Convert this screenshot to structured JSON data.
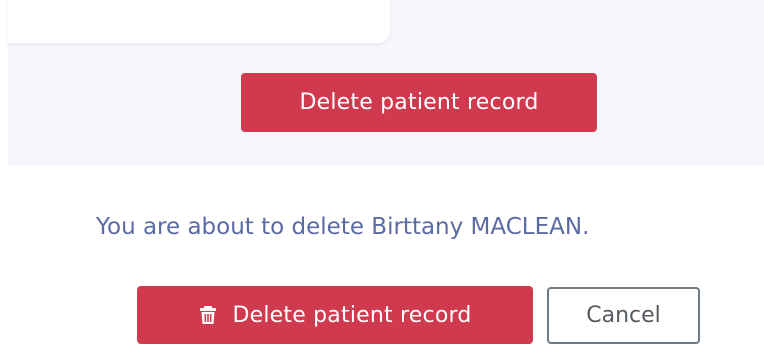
{
  "page": {
    "primary_delete_label": "Delete patient record",
    "confirmation": {
      "message": "You are about to delete Birttany MACLEAN.",
      "confirm_delete_label": "Delete patient record",
      "cancel_label": "Cancel"
    }
  },
  "icons": {
    "confirm_delete": "trash-icon"
  },
  "colors": {
    "danger": "#d03a4e",
    "message_text": "#5a6aa4",
    "panel_bg": "#f6f7fc"
  }
}
